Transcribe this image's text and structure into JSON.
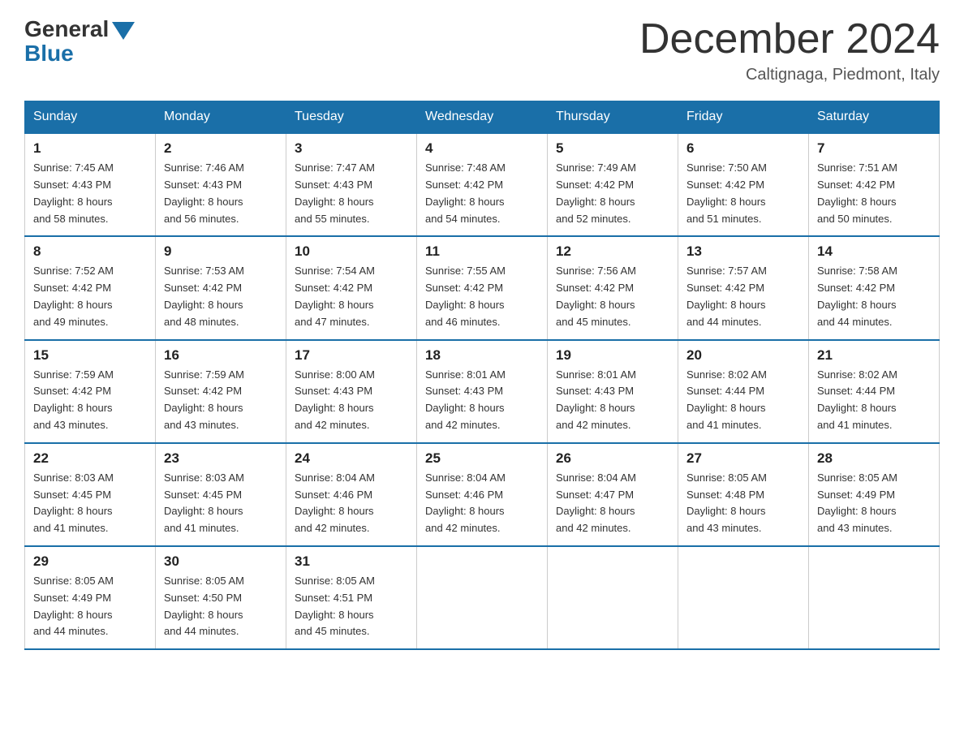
{
  "header": {
    "logo_general": "General",
    "logo_blue": "Blue",
    "month_title": "December 2024",
    "location": "Caltignaga, Piedmont, Italy"
  },
  "days_of_week": [
    "Sunday",
    "Monday",
    "Tuesday",
    "Wednesday",
    "Thursday",
    "Friday",
    "Saturday"
  ],
  "weeks": [
    [
      {
        "day": "1",
        "sunrise": "7:45 AM",
        "sunset": "4:43 PM",
        "daylight": "8 hours and 58 minutes."
      },
      {
        "day": "2",
        "sunrise": "7:46 AM",
        "sunset": "4:43 PM",
        "daylight": "8 hours and 56 minutes."
      },
      {
        "day": "3",
        "sunrise": "7:47 AM",
        "sunset": "4:43 PM",
        "daylight": "8 hours and 55 minutes."
      },
      {
        "day": "4",
        "sunrise": "7:48 AM",
        "sunset": "4:42 PM",
        "daylight": "8 hours and 54 minutes."
      },
      {
        "day": "5",
        "sunrise": "7:49 AM",
        "sunset": "4:42 PM",
        "daylight": "8 hours and 52 minutes."
      },
      {
        "day": "6",
        "sunrise": "7:50 AM",
        "sunset": "4:42 PM",
        "daylight": "8 hours and 51 minutes."
      },
      {
        "day": "7",
        "sunrise": "7:51 AM",
        "sunset": "4:42 PM",
        "daylight": "8 hours and 50 minutes."
      }
    ],
    [
      {
        "day": "8",
        "sunrise": "7:52 AM",
        "sunset": "4:42 PM",
        "daylight": "8 hours and 49 minutes."
      },
      {
        "day": "9",
        "sunrise": "7:53 AM",
        "sunset": "4:42 PM",
        "daylight": "8 hours and 48 minutes."
      },
      {
        "day": "10",
        "sunrise": "7:54 AM",
        "sunset": "4:42 PM",
        "daylight": "8 hours and 47 minutes."
      },
      {
        "day": "11",
        "sunrise": "7:55 AM",
        "sunset": "4:42 PM",
        "daylight": "8 hours and 46 minutes."
      },
      {
        "day": "12",
        "sunrise": "7:56 AM",
        "sunset": "4:42 PM",
        "daylight": "8 hours and 45 minutes."
      },
      {
        "day": "13",
        "sunrise": "7:57 AM",
        "sunset": "4:42 PM",
        "daylight": "8 hours and 44 minutes."
      },
      {
        "day": "14",
        "sunrise": "7:58 AM",
        "sunset": "4:42 PM",
        "daylight": "8 hours and 44 minutes."
      }
    ],
    [
      {
        "day": "15",
        "sunrise": "7:59 AM",
        "sunset": "4:42 PM",
        "daylight": "8 hours and 43 minutes."
      },
      {
        "day": "16",
        "sunrise": "7:59 AM",
        "sunset": "4:42 PM",
        "daylight": "8 hours and 43 minutes."
      },
      {
        "day": "17",
        "sunrise": "8:00 AM",
        "sunset": "4:43 PM",
        "daylight": "8 hours and 42 minutes."
      },
      {
        "day": "18",
        "sunrise": "8:01 AM",
        "sunset": "4:43 PM",
        "daylight": "8 hours and 42 minutes."
      },
      {
        "day": "19",
        "sunrise": "8:01 AM",
        "sunset": "4:43 PM",
        "daylight": "8 hours and 42 minutes."
      },
      {
        "day": "20",
        "sunrise": "8:02 AM",
        "sunset": "4:44 PM",
        "daylight": "8 hours and 41 minutes."
      },
      {
        "day": "21",
        "sunrise": "8:02 AM",
        "sunset": "4:44 PM",
        "daylight": "8 hours and 41 minutes."
      }
    ],
    [
      {
        "day": "22",
        "sunrise": "8:03 AM",
        "sunset": "4:45 PM",
        "daylight": "8 hours and 41 minutes."
      },
      {
        "day": "23",
        "sunrise": "8:03 AM",
        "sunset": "4:45 PM",
        "daylight": "8 hours and 41 minutes."
      },
      {
        "day": "24",
        "sunrise": "8:04 AM",
        "sunset": "4:46 PM",
        "daylight": "8 hours and 42 minutes."
      },
      {
        "day": "25",
        "sunrise": "8:04 AM",
        "sunset": "4:46 PM",
        "daylight": "8 hours and 42 minutes."
      },
      {
        "day": "26",
        "sunrise": "8:04 AM",
        "sunset": "4:47 PM",
        "daylight": "8 hours and 42 minutes."
      },
      {
        "day": "27",
        "sunrise": "8:05 AM",
        "sunset": "4:48 PM",
        "daylight": "8 hours and 43 minutes."
      },
      {
        "day": "28",
        "sunrise": "8:05 AM",
        "sunset": "4:49 PM",
        "daylight": "8 hours and 43 minutes."
      }
    ],
    [
      {
        "day": "29",
        "sunrise": "8:05 AM",
        "sunset": "4:49 PM",
        "daylight": "8 hours and 44 minutes."
      },
      {
        "day": "30",
        "sunrise": "8:05 AM",
        "sunset": "4:50 PM",
        "daylight": "8 hours and 44 minutes."
      },
      {
        "day": "31",
        "sunrise": "8:05 AM",
        "sunset": "4:51 PM",
        "daylight": "8 hours and 45 minutes."
      },
      null,
      null,
      null,
      null
    ]
  ],
  "labels": {
    "sunrise": "Sunrise: ",
    "sunset": "Sunset: ",
    "daylight": "Daylight: "
  }
}
